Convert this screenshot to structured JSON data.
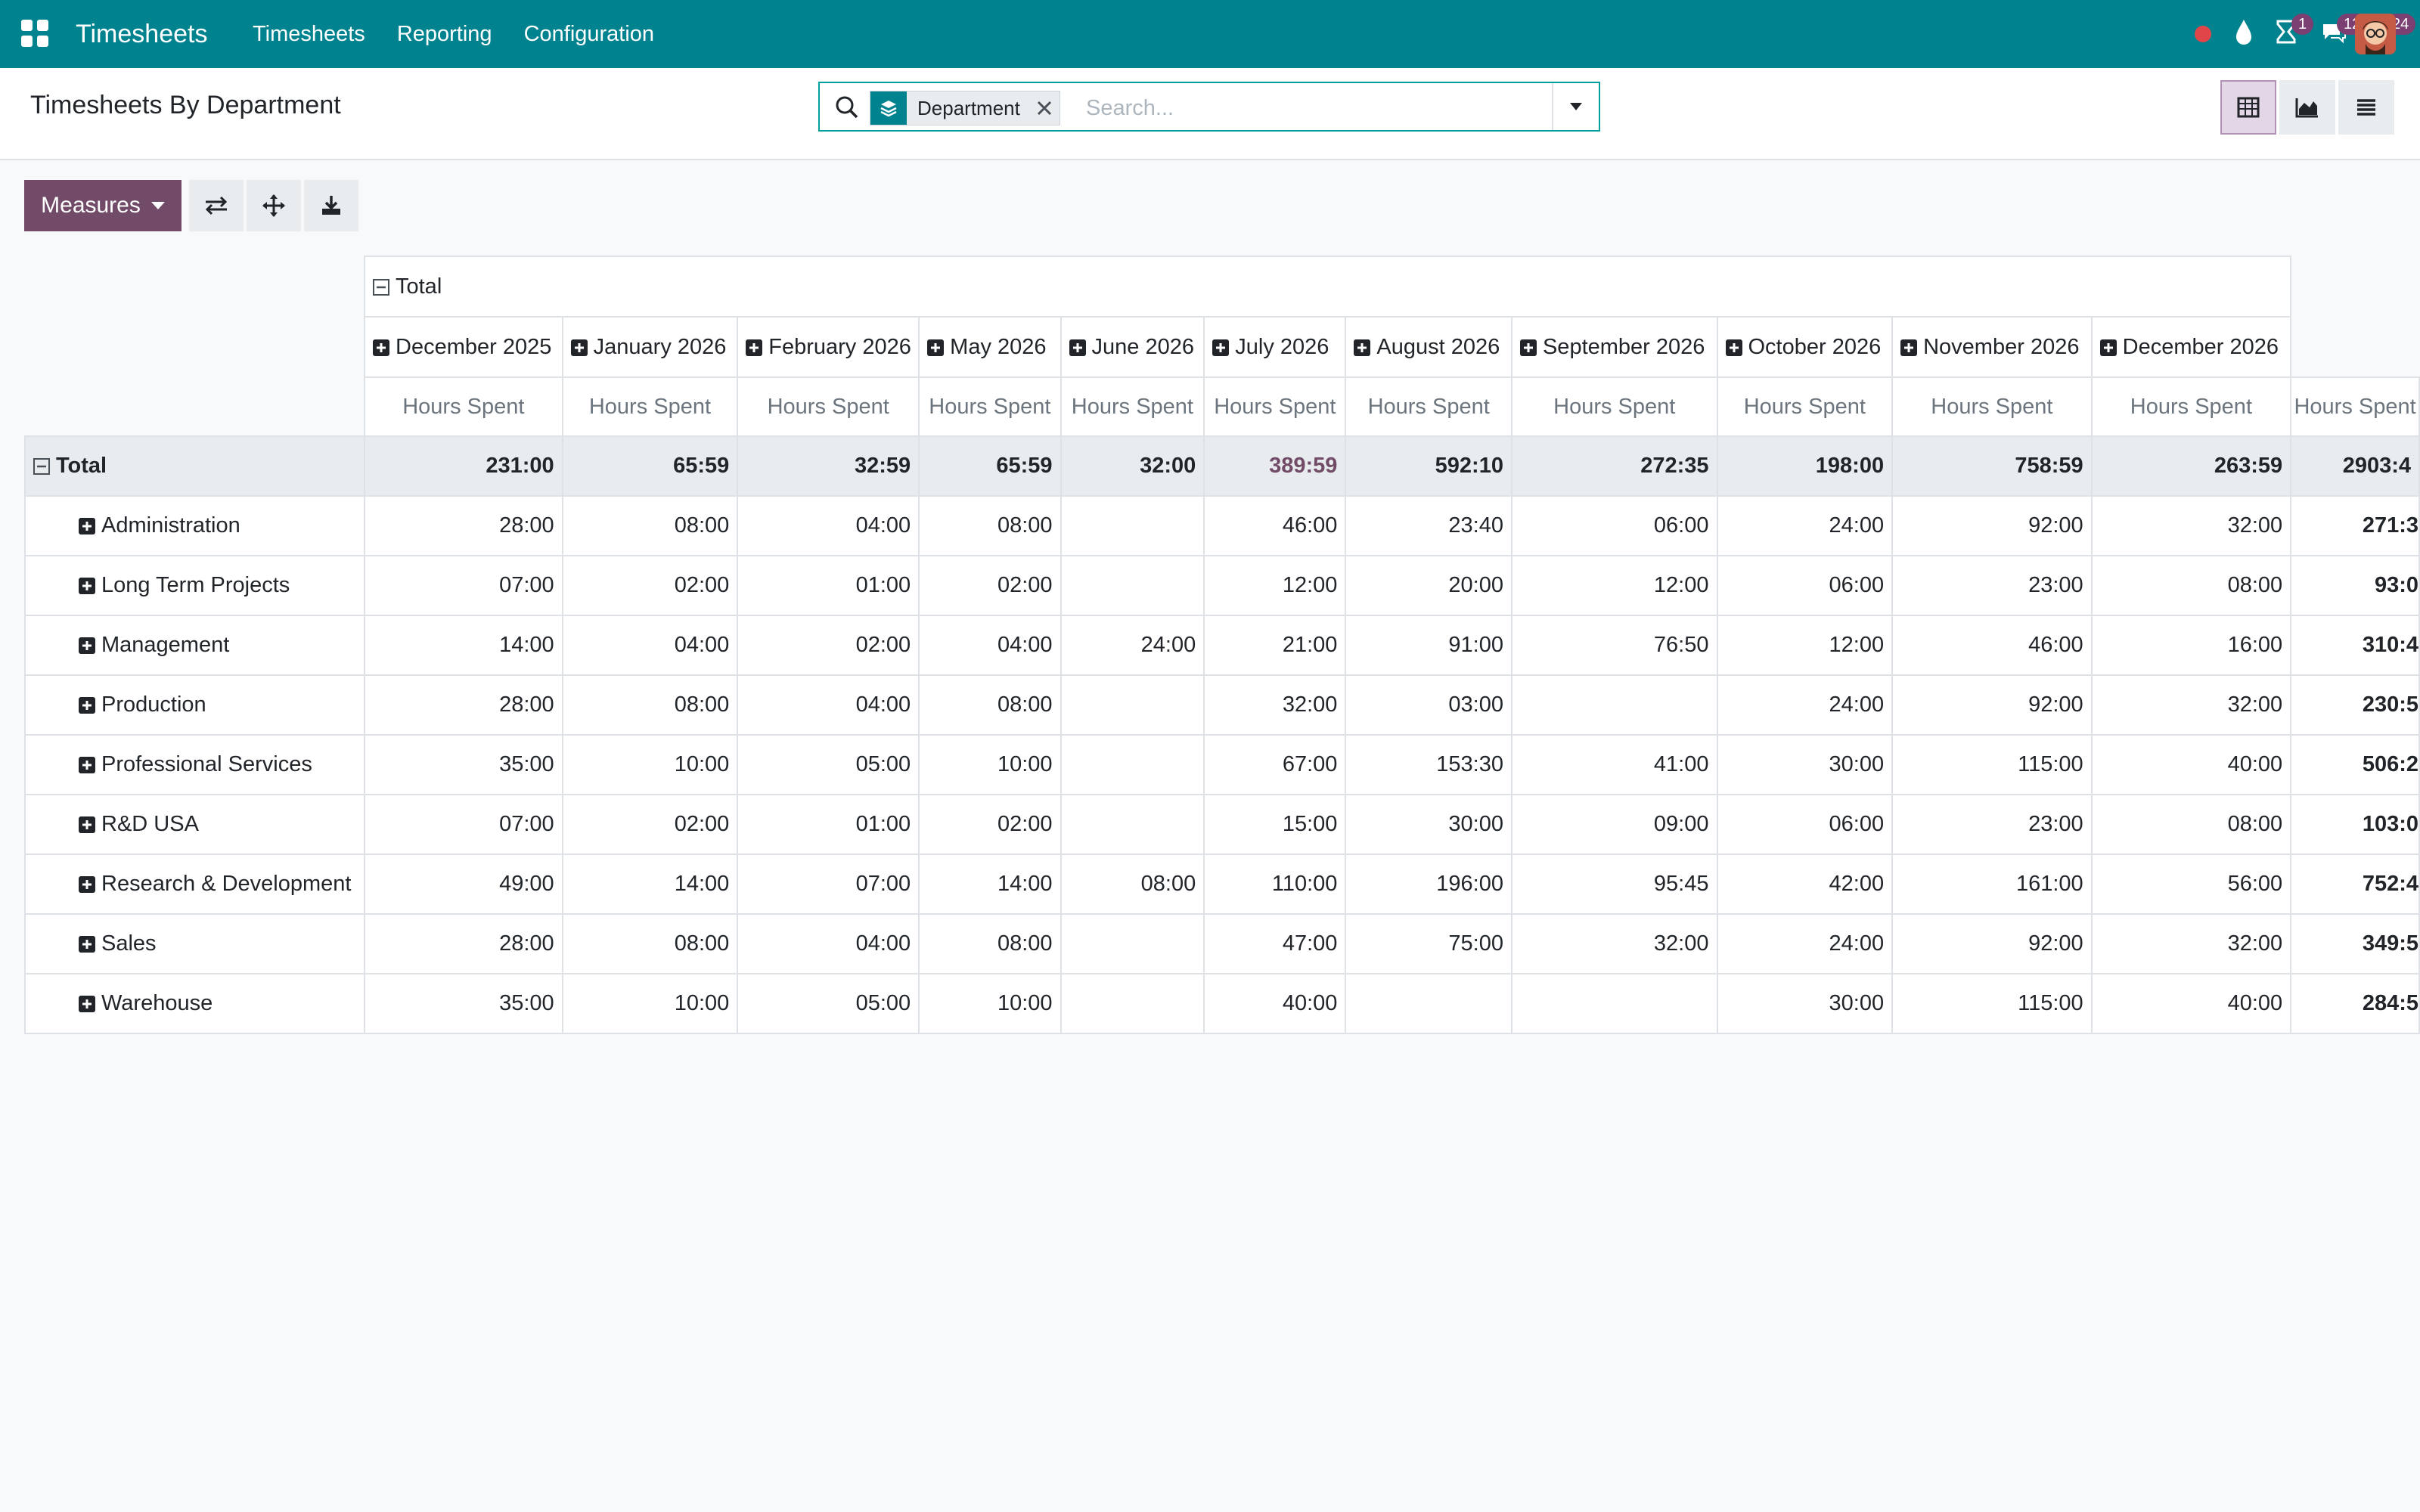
{
  "navbar": {
    "app_title": "Timesheets",
    "menu": [
      "Timesheets",
      "Reporting",
      "Configuration"
    ],
    "activity_badge": "1",
    "messages_badge": "125",
    "clock_badge": "24"
  },
  "control": {
    "page_title": "Timesheets By Department",
    "facet_label": "Department",
    "search_placeholder": "Search..."
  },
  "pivot": {
    "measures_label": "Measures",
    "top_header": "Total",
    "measure_label": "Hours Spent",
    "columns": [
      "December 2025",
      "January 2026",
      "February 2026",
      "May 2026",
      "June 2026",
      "July 2026",
      "August 2026",
      "September 2026",
      "October 2026",
      "November 2026",
      "December 2026"
    ],
    "total_label": "Total",
    "total_row": [
      "231:00",
      "65:59",
      "32:59",
      "65:59",
      "32:00",
      "389:59",
      "592:10",
      "272:35",
      "198:00",
      "758:59",
      "263:59",
      "2903:4"
    ],
    "rows": [
      {
        "label": "Administration",
        "values": [
          "28:00",
          "08:00",
          "04:00",
          "08:00",
          "",
          "46:00",
          "23:40",
          "06:00",
          "24:00",
          "92:00",
          "32:00",
          "271:3"
        ]
      },
      {
        "label": "Long Term Projects",
        "values": [
          "07:00",
          "02:00",
          "01:00",
          "02:00",
          "",
          "12:00",
          "20:00",
          "12:00",
          "06:00",
          "23:00",
          "08:00",
          "93:0"
        ]
      },
      {
        "label": "Management",
        "values": [
          "14:00",
          "04:00",
          "02:00",
          "04:00",
          "24:00",
          "21:00",
          "91:00",
          "76:50",
          "12:00",
          "46:00",
          "16:00",
          "310:4"
        ]
      },
      {
        "label": "Production",
        "values": [
          "28:00",
          "08:00",
          "04:00",
          "08:00",
          "",
          "32:00",
          "03:00",
          "",
          "24:00",
          "92:00",
          "32:00",
          "230:5"
        ]
      },
      {
        "label": "Professional Services",
        "values": [
          "35:00",
          "10:00",
          "05:00",
          "10:00",
          "",
          "67:00",
          "153:30",
          "41:00",
          "30:00",
          "115:00",
          "40:00",
          "506:2"
        ]
      },
      {
        "label": "R&D USA",
        "values": [
          "07:00",
          "02:00",
          "01:00",
          "02:00",
          "",
          "15:00",
          "30:00",
          "09:00",
          "06:00",
          "23:00",
          "08:00",
          "103:0"
        ]
      },
      {
        "label": "Research & Development",
        "values": [
          "49:00",
          "14:00",
          "07:00",
          "14:00",
          "08:00",
          "110:00",
          "196:00",
          "95:45",
          "42:00",
          "161:00",
          "56:00",
          "752:4"
        ]
      },
      {
        "label": "Sales",
        "values": [
          "28:00",
          "08:00",
          "04:00",
          "08:00",
          "",
          "47:00",
          "75:00",
          "32:00",
          "24:00",
          "92:00",
          "32:00",
          "349:5"
        ]
      },
      {
        "label": "Warehouse",
        "values": [
          "35:00",
          "10:00",
          "05:00",
          "10:00",
          "",
          "40:00",
          "",
          "",
          "30:00",
          "115:00",
          "40:00",
          "284:5"
        ]
      }
    ]
  },
  "colors": {
    "nav": "#00838f",
    "primary": "#714b67",
    "highlight": "#714b67"
  }
}
